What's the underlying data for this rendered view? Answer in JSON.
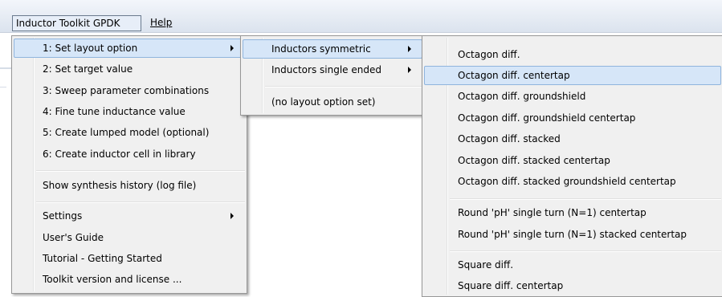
{
  "menubar": {
    "items": [
      "Inductor Toolkit GPDK",
      "Help"
    ]
  },
  "main_menu": {
    "items": [
      "1: Set layout option",
      "2: Set target value",
      "3: Sweep parameter combinations",
      "4: Fine tune inductance value",
      "5: Create lumped model (optional)",
      "6: Create inductor cell in library",
      "Show synthesis history (log file)",
      "Settings",
      "User's Guide",
      "Tutorial - Getting Started",
      "Toolkit version and license ..."
    ],
    "highlighted": "1: Set layout option"
  },
  "layout_menu": {
    "items": [
      "Inductors symmetric",
      "Inductors single ended",
      "(no layout option set)"
    ],
    "highlighted": "Inductors symmetric"
  },
  "symmetric_menu": {
    "items": [
      "Octagon diff.",
      "Octagon diff. centertap",
      "Octagon diff. groundshield",
      "Octagon diff. groundshield centertap",
      "Octagon diff. stacked",
      "Octagon diff. stacked centertap",
      "Octagon diff. stacked groundshield centertap",
      "Round 'pH' single turn (N=1) centertap",
      "Round 'pH' single turn (N=1) stacked centertap",
      "Square diff.",
      "Square diff. centertap"
    ],
    "highlighted": "Octagon diff. centertap"
  }
}
